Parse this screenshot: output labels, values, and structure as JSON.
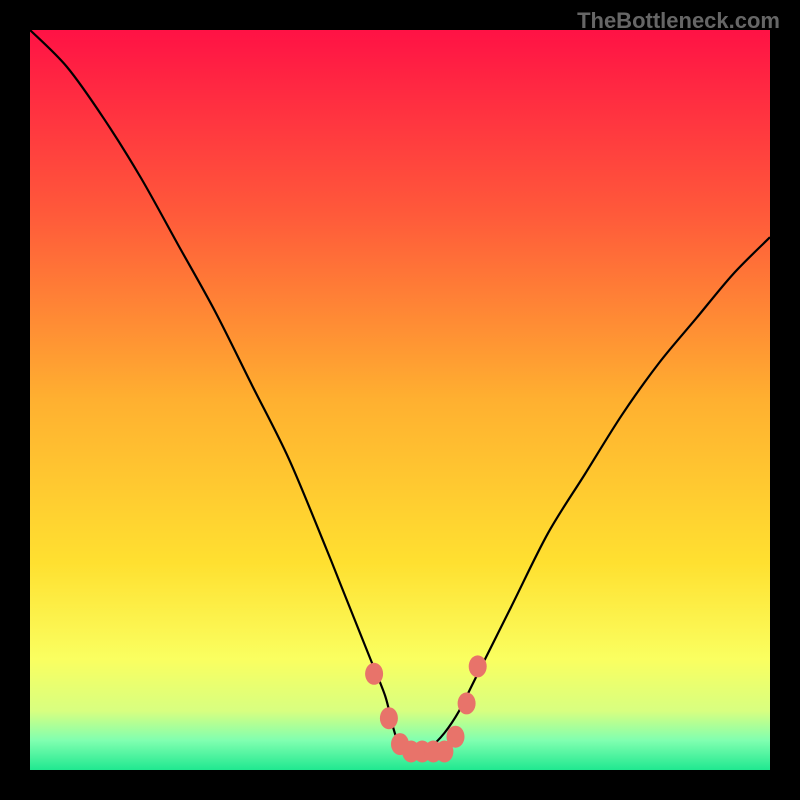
{
  "watermark": "TheBottleneck.com",
  "chart_data": {
    "type": "line",
    "title": "",
    "xlabel": "",
    "ylabel": "",
    "xlim": [
      0,
      100
    ],
    "ylim": [
      0,
      100
    ],
    "series": [
      {
        "name": "bottleneck-curve",
        "x": [
          0,
          5,
          10,
          15,
          20,
          25,
          30,
          35,
          40,
          42,
          44,
          46,
          48,
          49,
          50,
          51,
          52,
          54,
          56,
          58,
          60,
          65,
          70,
          75,
          80,
          85,
          90,
          95,
          100
        ],
        "values": [
          100,
          95,
          88,
          80,
          71,
          62,
          52,
          42,
          30,
          25,
          20,
          15,
          10,
          6,
          3,
          2,
          2,
          3,
          5,
          8,
          12,
          22,
          32,
          40,
          48,
          55,
          61,
          67,
          72
        ]
      }
    ],
    "markers": {
      "name": "highlighted-points",
      "color": "#e8736a",
      "points": [
        {
          "x": 46.5,
          "y": 13
        },
        {
          "x": 48.5,
          "y": 7
        },
        {
          "x": 50,
          "y": 3.5
        },
        {
          "x": 51.5,
          "y": 2.5
        },
        {
          "x": 53,
          "y": 2.5
        },
        {
          "x": 54.5,
          "y": 2.5
        },
        {
          "x": 56,
          "y": 2.5
        },
        {
          "x": 57.5,
          "y": 4.5
        },
        {
          "x": 59,
          "y": 9
        },
        {
          "x": 60.5,
          "y": 14
        }
      ]
    },
    "gradient_stops": [
      {
        "offset": 0,
        "color": "#ff1245"
      },
      {
        "offset": 0.25,
        "color": "#ff5a3a"
      },
      {
        "offset": 0.5,
        "color": "#ffb030"
      },
      {
        "offset": 0.72,
        "color": "#ffe030"
      },
      {
        "offset": 0.85,
        "color": "#faff60"
      },
      {
        "offset": 0.92,
        "color": "#d8ff80"
      },
      {
        "offset": 0.96,
        "color": "#80ffb0"
      },
      {
        "offset": 1.0,
        "color": "#20e890"
      }
    ]
  }
}
